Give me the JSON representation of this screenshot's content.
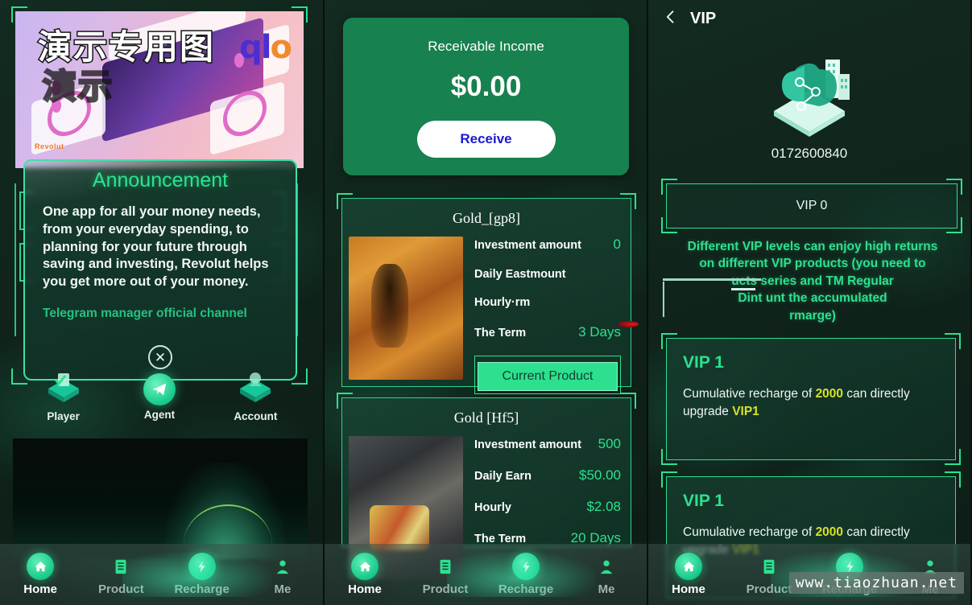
{
  "panel1": {
    "banner": {
      "cjk_text": "演示专用图",
      "cjk_shadow": "演示",
      "logo_text": "ql",
      "logo_accent": "o",
      "brand": "Revolut"
    },
    "announcement": {
      "title": "Announcement",
      "body": "One app for all your money needs, from your everyday spending, to planning for your future through saving and investing, Revolut helps you get more out of your money.",
      "telegram": "Telegram manager official channel",
      "close_icon": "✕"
    },
    "quick_icons": [
      {
        "label": "Player",
        "icon": "player-iso-icon"
      },
      {
        "label": "Agent",
        "icon": "telegram-paper-plane-icon"
      },
      {
        "label": "Account",
        "icon": "account-iso-icon"
      }
    ],
    "nav": [
      {
        "label": "Home",
        "icon": "home-icon",
        "active": true
      },
      {
        "label": "Product",
        "icon": "document-icon",
        "active": false
      },
      {
        "label": "Recharge",
        "icon": "recharge-icon",
        "active": false
      },
      {
        "label": "Me",
        "icon": "person-icon",
        "active": false
      }
    ]
  },
  "panel2": {
    "income": {
      "title": "Receivable Income",
      "value": "$0.00",
      "button": "Receive"
    },
    "products": [
      {
        "title": "Gold_[gp8]",
        "image": "gold-mine-orange",
        "rows": [
          {
            "key": "Investment amount",
            "value": "0"
          },
          {
            "key": "Daily Eastmount",
            "value": ""
          },
          {
            "key": "Hourly·rm",
            "value": ""
          },
          {
            "key": "The Term",
            "value": "3 Days"
          }
        ],
        "action": "Current Product"
      },
      {
        "title": "Gold [Hf5]",
        "image": "gold-mine-grey",
        "rows": [
          {
            "key": "Investment amount",
            "value": "500"
          },
          {
            "key": "Daily Earn",
            "value": "$50.00"
          },
          {
            "key": "Hourly",
            "value": "$2.08"
          },
          {
            "key": "The Term",
            "value": "20 Days"
          }
        ],
        "action": ""
      }
    ],
    "nav": [
      {
        "label": "Home",
        "icon": "home-icon",
        "active": true
      },
      {
        "label": "Product",
        "icon": "document-icon",
        "active": false
      },
      {
        "label": "Recharge",
        "icon": "recharge-icon",
        "active": false
      },
      {
        "label": "Me",
        "icon": "person-icon",
        "active": false
      }
    ]
  },
  "panel3": {
    "header": {
      "back_icon": "chevron-left-icon",
      "title": "VIP"
    },
    "user_id": "0172600840",
    "vip_level": "VIP 0",
    "description_line1": "Different VIP levels can enjoy high returns",
    "description_line2": "on different VIP products (you need to",
    "description_line3": "ucts series and TM Regular",
    "description_line4": "Dint unt the accumulated",
    "description_line5": "rmarge)",
    "cards": [
      {
        "title": "VIP 1",
        "text_before": "Cumulative recharge of ",
        "amount": "2000",
        "text_middle": " can directly upgrade ",
        "level": "VIP1",
        "text_after": ""
      },
      {
        "title": "VIP 1",
        "text_before": "Cumulative recharge of ",
        "amount": "2000",
        "text_middle": " can directly upgrade ",
        "level": "VIP1",
        "text_after": ""
      }
    ],
    "nav": [
      {
        "label": "Home",
        "icon": "home-icon",
        "active": true
      },
      {
        "label": "Product",
        "icon": "document-icon",
        "active": false
      },
      {
        "label": "Recharge",
        "icon": "recharge-icon",
        "active": false
      },
      {
        "label": "Me",
        "icon": "person-icon",
        "active": false
      }
    ]
  },
  "watermark": "www.tiaozhuan.net",
  "colors": {
    "accent_green": "#2de08f",
    "card_green": "#17814f",
    "yellow": "#d8e029",
    "receive_blue": "#1a1ad0"
  }
}
